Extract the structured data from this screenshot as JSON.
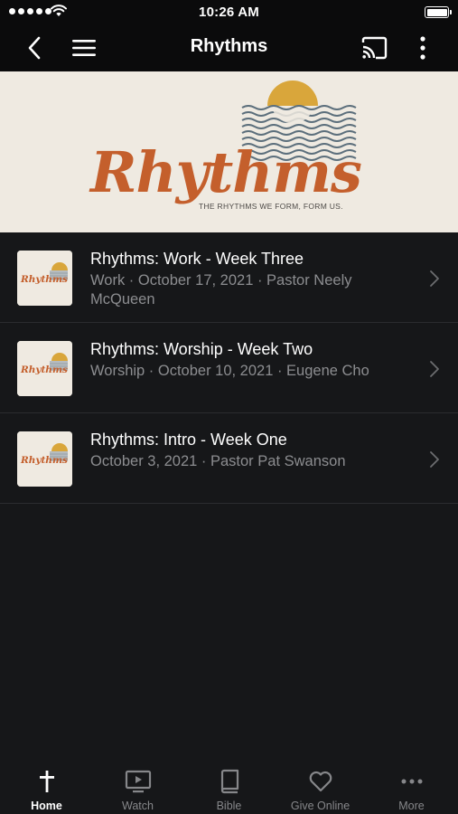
{
  "status_bar": {
    "time": "10:26 AM"
  },
  "nav": {
    "title": "Rhythms"
  },
  "hero": {
    "wordmark": "Rhythms",
    "tagline": "THE RHYTHMS WE FORM, FORM US."
  },
  "thumbnail_wordmark": "Rhythms",
  "sermons": [
    {
      "title": "Rhythms: Work - Week Three",
      "subtitle": "Work · October 17, 2021 · Pastor Neely McQueen"
    },
    {
      "title": "Rhythms: Worship - Week Two",
      "subtitle": "Worship · October 10, 2021 · Eugene Cho"
    },
    {
      "title": "Rhythms: Intro - Week One",
      "subtitle": "October 3, 2021 · Pastor Pat Swanson"
    }
  ],
  "tabs": [
    {
      "label": "Home",
      "icon": "cross-icon",
      "active": true
    },
    {
      "label": "Watch",
      "icon": "tv-play-icon",
      "active": false
    },
    {
      "label": "Bible",
      "icon": "book-icon",
      "active": false
    },
    {
      "label": "Give Online",
      "icon": "heart-icon",
      "active": false
    },
    {
      "label": "More",
      "icon": "more-dots-icon",
      "active": false
    }
  ],
  "colors": {
    "background": "#161719",
    "bar": "#0b0b0c",
    "brand_orange": "#c45f2c",
    "sun_gold": "#d9a63b",
    "wave_slate": "#5c6f7c",
    "cream": "#efeae1",
    "muted_text": "#8c8d90"
  }
}
